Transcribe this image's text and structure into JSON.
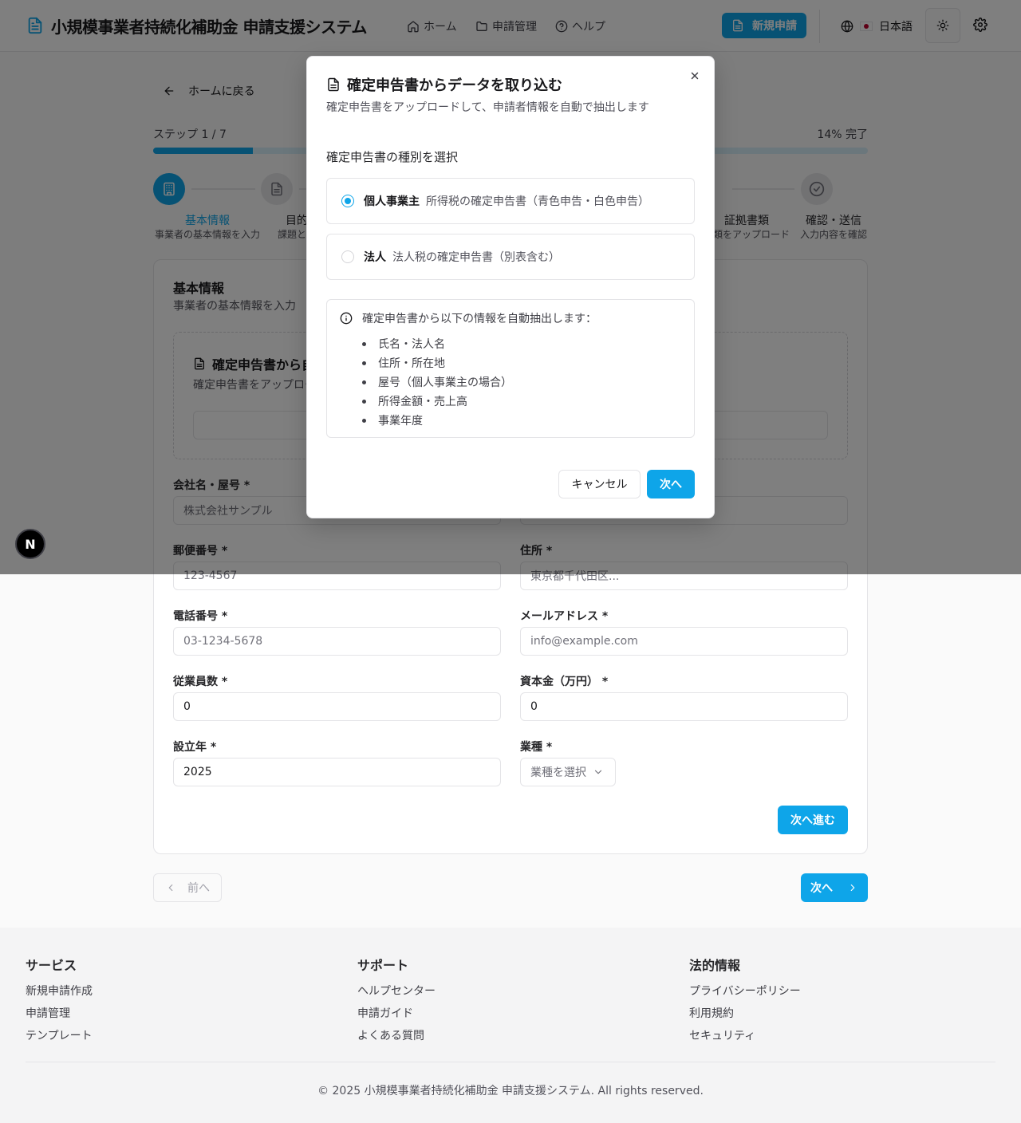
{
  "header": {
    "app_title": "小規模事業者持続化補助金 申請支援システム",
    "nav": [
      {
        "label": "ホーム",
        "icon": "home-icon"
      },
      {
        "label": "申請管理",
        "icon": "folder-icon"
      },
      {
        "label": "ヘルプ",
        "icon": "help-circle-icon"
      }
    ],
    "new_application": "新規申請",
    "language": "日本語"
  },
  "main": {
    "back_label": "ホームに戻る",
    "step_label": "ステップ 1 / 7",
    "progress_label": "14% 完了",
    "progress_value": 0.14,
    "steps": [
      {
        "title": "基本情報",
        "desc": "事業者の基本情報を入力"
      },
      {
        "title": "目的",
        "desc": "課題と解"
      },
      {
        "title": "証拠書類",
        "desc": "書類をアップロード"
      },
      {
        "title": "確認・送信",
        "desc": "入力内容を確認"
      }
    ],
    "card": {
      "title": "基本情報",
      "subtitle": "事業者の基本情報を入力",
      "upload_title": "確定申告書から自",
      "upload_sub": "確定申告書をアップロー",
      "fields": {
        "company_label": "会社名・屋号 *",
        "company_placeholder": "株式会社サンプル",
        "postal_label": "郵便番号 *",
        "postal_placeholder": "123-4567",
        "address_label": "住所 *",
        "address_placeholder": "東京都千代田区...",
        "phone_label": "電話番号 *",
        "phone_placeholder": "03-1234-5678",
        "email_label": "メールアドレス *",
        "email_placeholder": "info@example.com",
        "employees_label": "従業員数 *",
        "employees_value": "0",
        "capital_label": "資本金（万円） *",
        "capital_value": "0",
        "founded_label": "設立年 *",
        "founded_value": "2025",
        "industry_label": "業種 *",
        "industry_placeholder": "業種を選択"
      },
      "next_go": "次へ進む"
    },
    "prev": "前へ",
    "next": "次へ"
  },
  "footer": {
    "service_title": "サービス",
    "service_links": [
      "新規申請作成",
      "申請管理",
      "テンプレート"
    ],
    "support_title": "サポート",
    "support_links": [
      "ヘルプセンター",
      "申請ガイド",
      "よくある質問"
    ],
    "legal_title": "法的情報",
    "legal_links": [
      "プライバシーポリシー",
      "利用規約",
      "セキュリティ"
    ],
    "copyright": "© 2025 小規模事業者持続化補助金 申請支援システム. All rights reserved."
  },
  "modal": {
    "title": "確定申告書からデータを取り込む",
    "subtitle": "確定申告書をアップロードして、申請者情報を自動で抽出します",
    "section": "確定申告書の種別を選択",
    "options": [
      {
        "label": "個人事業主",
        "desc": "所得税の確定申告書（青色申告・白色申告）",
        "selected": true
      },
      {
        "label": "法人",
        "desc": "法人税の確定申告書（別表含む）",
        "selected": false
      }
    ],
    "info_head": "確定申告書から以下の情報を自動抽出します：",
    "info_items": [
      "氏名・法人名",
      "住所・所在地",
      "屋号（個人事業主の場合）",
      "所得金額・売上高",
      "事業年度"
    ],
    "cancel": "キャンセル",
    "next": "次へ"
  },
  "badge": "N",
  "colors": {
    "accent": "#0ea5e9",
    "overlay": "rgba(0,0,0,0.5)"
  }
}
